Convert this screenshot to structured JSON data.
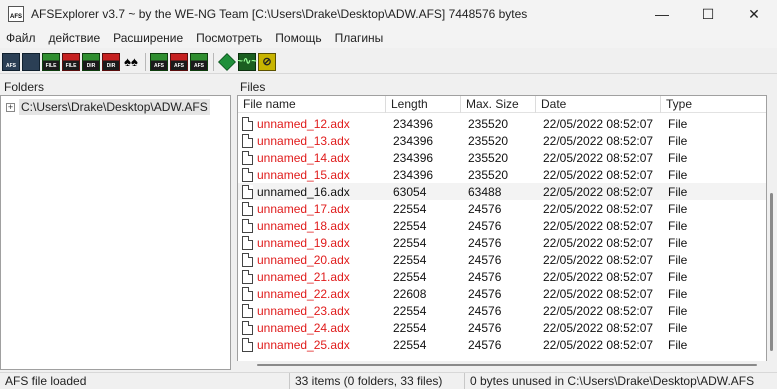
{
  "window": {
    "title": "AFSExplorer v3.7  ~ by the WE-NG Team [C:\\Users\\Drake\\Desktop\\ADW.AFS] 7448576 bytes",
    "icon_label": "AFS"
  },
  "menu": [
    "Файл",
    "действие",
    "Расширение",
    "Посмотреть",
    "Помощь",
    "Плагины"
  ],
  "toolbar": {
    "buttons": [
      {
        "name": "afs-open-icon",
        "label": "AFS",
        "style": "c-dark"
      },
      {
        "name": "save-icon",
        "label": "",
        "style": "c-dark"
      },
      {
        "name": "import-file-icon",
        "label": "FILE",
        "style": "c-green"
      },
      {
        "name": "export-file-icon",
        "label": "FILE",
        "style": "c-red"
      },
      {
        "name": "import-dir-icon",
        "label": "DIR",
        "style": "c-green"
      },
      {
        "name": "export-dir-icon",
        "label": "DIR",
        "style": "c-red"
      },
      {
        "name": "binoculars-icon",
        "label": "♠♠",
        "style": "c-plain"
      },
      {
        "sep": true
      },
      {
        "name": "afs-build-icon",
        "label": "AFS",
        "style": "c-green"
      },
      {
        "name": "afs-extract-icon",
        "label": "AFS",
        "style": "c-red"
      },
      {
        "name": "afs-tools-icon",
        "label": "AFS",
        "style": "c-green"
      },
      {
        "sep": true
      },
      {
        "name": "emerald-icon",
        "label": "",
        "style": "c-emerald"
      },
      {
        "name": "waveform-icon",
        "label": "~∿~",
        "style": "c-wave"
      },
      {
        "name": "plugin-icon",
        "label": "⊘",
        "style": "c-yellow"
      }
    ]
  },
  "folders": {
    "label": "Folders",
    "tree_root": "C:\\Users\\Drake\\Desktop\\ADW.AFS",
    "expander": "+"
  },
  "files": {
    "label": "Files",
    "columns": [
      "File name",
      "Length",
      "Max. Size",
      "Date",
      "Type"
    ],
    "rows": [
      {
        "name": "unnamed_12.adx",
        "length": "234396",
        "max": "235520",
        "date": "22/05/2022 08:52:07",
        "type": "File",
        "red": true
      },
      {
        "name": "unnamed_13.adx",
        "length": "234396",
        "max": "235520",
        "date": "22/05/2022 08:52:07",
        "type": "File",
        "red": true
      },
      {
        "name": "unnamed_14.adx",
        "length": "234396",
        "max": "235520",
        "date": "22/05/2022 08:52:07",
        "type": "File",
        "red": true
      },
      {
        "name": "unnamed_15.adx",
        "length": "234396",
        "max": "235520",
        "date": "22/05/2022 08:52:07",
        "type": "File",
        "red": true
      },
      {
        "name": "unnamed_16.adx",
        "length": "63054",
        "max": "63488",
        "date": "22/05/2022 08:52:07",
        "type": "File",
        "red": false,
        "selected": true
      },
      {
        "name": "unnamed_17.adx",
        "length": "22554",
        "max": "24576",
        "date": "22/05/2022 08:52:07",
        "type": "File",
        "red": true
      },
      {
        "name": "unnamed_18.adx",
        "length": "22554",
        "max": "24576",
        "date": "22/05/2022 08:52:07",
        "type": "File",
        "red": true
      },
      {
        "name": "unnamed_19.adx",
        "length": "22554",
        "max": "24576",
        "date": "22/05/2022 08:52:07",
        "type": "File",
        "red": true
      },
      {
        "name": "unnamed_20.adx",
        "length": "22554",
        "max": "24576",
        "date": "22/05/2022 08:52:07",
        "type": "File",
        "red": true
      },
      {
        "name": "unnamed_21.adx",
        "length": "22554",
        "max": "24576",
        "date": "22/05/2022 08:52:07",
        "type": "File",
        "red": true
      },
      {
        "name": "unnamed_22.adx",
        "length": "22608",
        "max": "24576",
        "date": "22/05/2022 08:52:07",
        "type": "File",
        "red": true
      },
      {
        "name": "unnamed_23.adx",
        "length": "22554",
        "max": "24576",
        "date": "22/05/2022 08:52:07",
        "type": "File",
        "red": true
      },
      {
        "name": "unnamed_24.adx",
        "length": "22554",
        "max": "24576",
        "date": "22/05/2022 08:52:07",
        "type": "File",
        "red": true
      },
      {
        "name": "unnamed_25.adx",
        "length": "22554",
        "max": "24576",
        "date": "22/05/2022 08:52:07",
        "type": "File",
        "red": true
      }
    ]
  },
  "status": {
    "left": "AFS file loaded",
    "middle": "33 items (0 folders, 33 files)",
    "right": "0 bytes unused in C:\\Users\\Drake\\Desktop\\ADW.AFS"
  },
  "colors": {
    "missing_file_text": "#e01b1b",
    "selected_row": "#f3f3f3"
  }
}
